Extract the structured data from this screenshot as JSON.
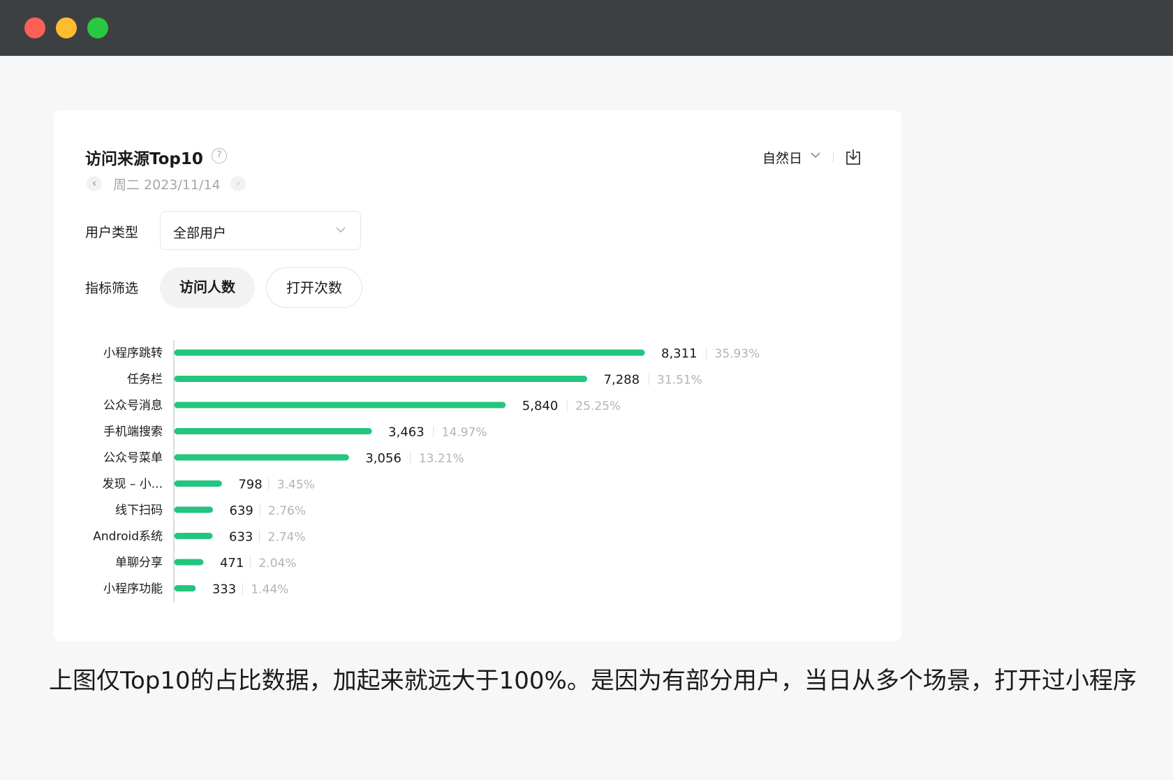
{
  "window": {
    "controls": [
      "close",
      "minimize",
      "zoom"
    ]
  },
  "card": {
    "title": "访问来源Top10",
    "help_icon": "?",
    "date": "周二 2023/11/14",
    "prev_icon": "‹",
    "next_icon": "›",
    "period": "自然日",
    "icons": {
      "period_dropdown": "chevron-down-icon",
      "download": "download-icon",
      "help": "question-circle-icon"
    }
  },
  "filters": {
    "user_type_label": "用户类型",
    "user_type_value": "全部用户",
    "metric_label": "指标筛选",
    "metric_options": [
      "访问人数",
      "打开次数"
    ],
    "metric_selected": "访问人数"
  },
  "chart_data": {
    "type": "bar",
    "orientation": "horizontal",
    "categories": [
      "小程序跳转",
      "任务栏",
      "公众号消息",
      "手机端搜索",
      "公众号菜单",
      "发现 – 小...",
      "线下扫码",
      "Android系统",
      "单聊分享",
      "小程序功能"
    ],
    "values": [
      8311,
      7288,
      5840,
      3463,
      3056,
      798,
      639,
      633,
      471,
      333
    ],
    "value_labels": [
      "8,311",
      "7,288",
      "5,840",
      "3,463",
      "3,056",
      "798",
      "639",
      "633",
      "471",
      "333"
    ],
    "percent_labels": [
      "35.93%",
      "31.51%",
      "25.25%",
      "14.97%",
      "13.21%",
      "3.45%",
      "2.76%",
      "2.74%",
      "2.04%",
      "1.44%"
    ],
    "bar_color": "#23c57f",
    "grid": false
  },
  "footer": {
    "text": "上图仅Top10的占比数据，加起来就远大于100%。是因为有部分用户，当日从多个场景，打开过小程序"
  }
}
